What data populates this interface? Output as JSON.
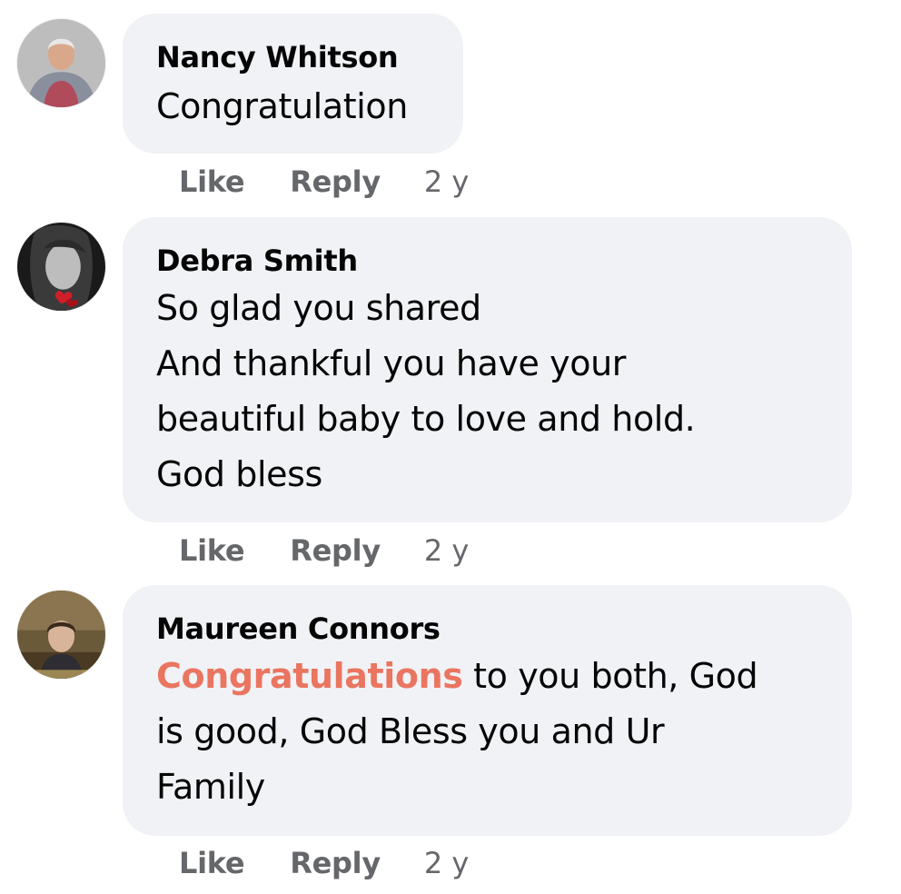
{
  "comments": [
    {
      "author": "Nancy Whitson",
      "text": "Congratulation",
      "actions": {
        "like": "Like",
        "reply": "Reply"
      },
      "time": "2 y"
    },
    {
      "author": "Debra Smith",
      "text": "So glad you shared\nAnd thankful you have your\nbeautiful baby to love and hold.\nGod bless",
      "actions": {
        "like": "Like",
        "reply": "Reply"
      },
      "time": "2 y"
    },
    {
      "author": "Maureen Connors",
      "mention": "Congratulations",
      "text_after_mention": " to you both, God\nis good, God Bless you and Ur\nFamily",
      "actions": {
        "like": "Like",
        "reply": "Reply"
      },
      "time": "2 y"
    }
  ],
  "colors": {
    "bubble_bg": "#f0f2f5",
    "text": "#050505",
    "secondary_text": "#65676b",
    "mention": "#ea7560"
  }
}
